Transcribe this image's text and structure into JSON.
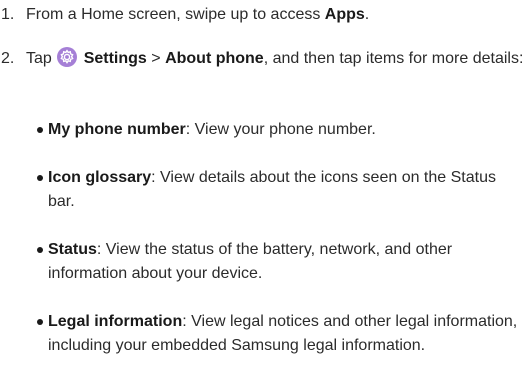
{
  "steps": [
    {
      "number": "1.",
      "text_before": "From a Home screen, swipe up to access ",
      "bold": "Apps",
      "text_after": "."
    },
    {
      "number": "2.",
      "tap_word": "Tap ",
      "settings_label": "Settings",
      "separator": " > ",
      "about_label": "About phone",
      "rest": ", and then tap items for more details:"
    }
  ],
  "bullets": [
    {
      "title": "My phone number",
      "text": ": View your phone number."
    },
    {
      "title": "Icon glossary",
      "text": ": View details about the icons seen on the Status bar."
    },
    {
      "title": "Status",
      "text": ": View the status of the battery, network, and other information about your device."
    },
    {
      "title": "Legal information",
      "text": ": View legal notices and other legal information, including your embedded Samsung legal information."
    }
  ],
  "icons": {
    "settings": "gear-icon",
    "settings_color": "#a57fd6"
  }
}
